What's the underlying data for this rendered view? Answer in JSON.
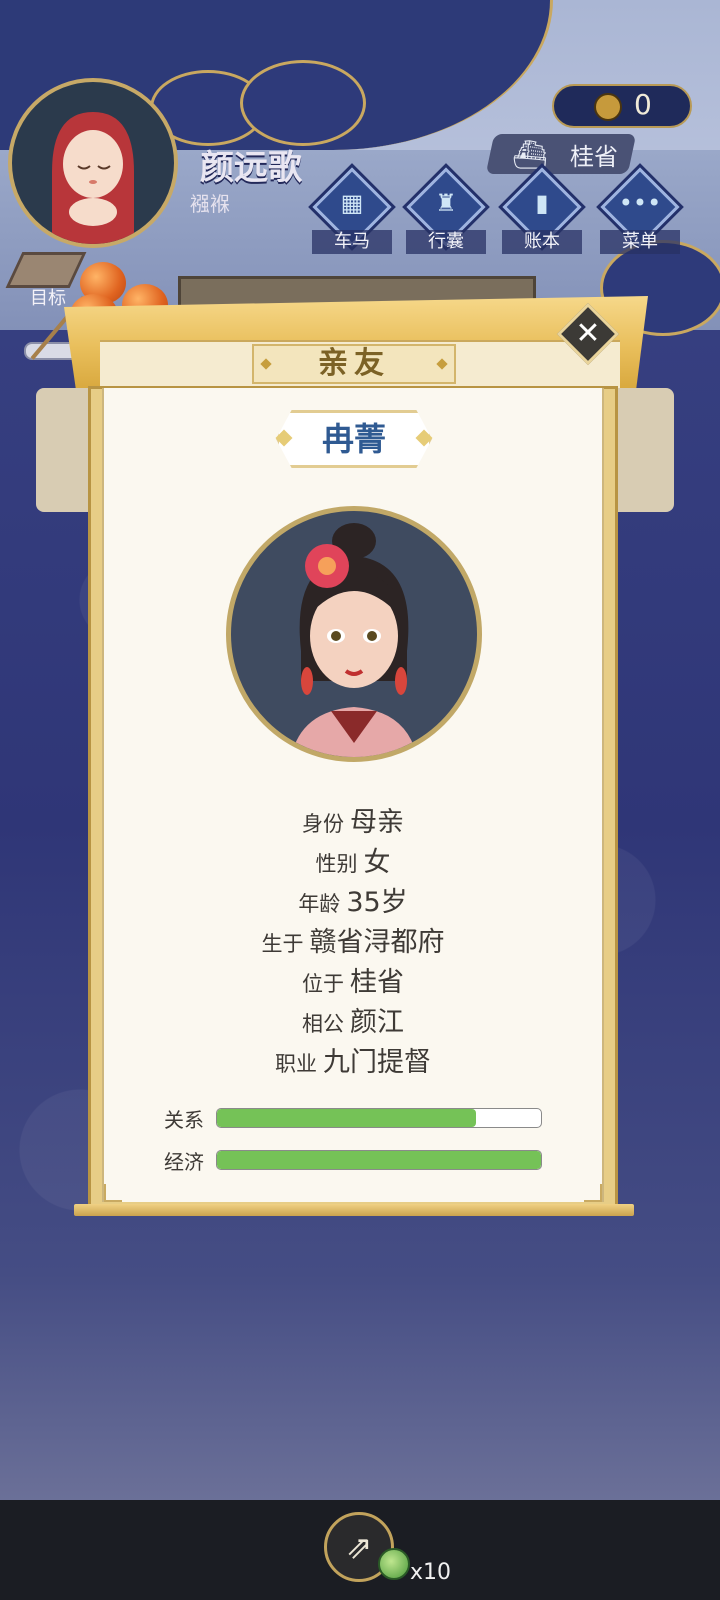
{
  "player": {
    "name": "颜远歌",
    "title": "襁褓"
  },
  "currency": {
    "amount": "0",
    "icon": "copper-coin-icon"
  },
  "location": {
    "name": "桂省",
    "icon": "iron-icon"
  },
  "nav": [
    {
      "label": "车马",
      "icon": "carriage-icon"
    },
    {
      "label": "行囊",
      "icon": "bag-icon"
    },
    {
      "label": "账本",
      "icon": "ledger-icon"
    },
    {
      "label": "菜单",
      "icon": "menu-dots-icon"
    }
  ],
  "goal": {
    "label": "目标"
  },
  "modal": {
    "title": "亲友",
    "close_icon": "close-icon"
  },
  "relative": {
    "name": "冉菁",
    "fields": [
      {
        "label": "身份",
        "value": "母亲"
      },
      {
        "label": "性别",
        "value": "女"
      },
      {
        "label": "年龄",
        "value": "35岁"
      },
      {
        "label": "生于",
        "value": "赣省浔都府"
      },
      {
        "label": "位于",
        "value": "桂省"
      },
      {
        "label": "相公",
        "value": "颜江"
      },
      {
        "label": "职业",
        "value": "九门提督"
      }
    ],
    "bars": [
      {
        "label": "关系",
        "value": 0.8
      },
      {
        "label": "经济",
        "value": 1.0
      }
    ],
    "bar_color": "#75c257"
  },
  "footer": {
    "share_icon": "share-icon",
    "reward_count": "x10"
  }
}
